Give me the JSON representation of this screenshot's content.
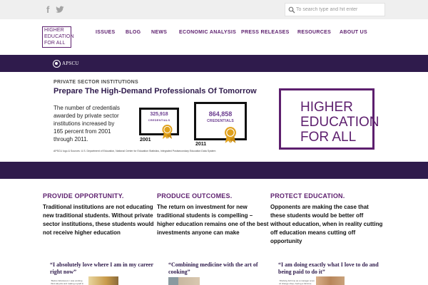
{
  "topbar": {
    "social": [
      "facebook-icon",
      "twitter-icon"
    ],
    "search": {
      "placeholder": "To search type and hit enter",
      "icon": "search-icon"
    }
  },
  "header": {
    "logo_lines": [
      "HIGHER",
      "EDUCATION",
      "FOR ALL"
    ],
    "nav": [
      "ISSUES",
      "BLOG",
      "NEWS",
      "ECONOMIC ANALYSIS",
      "PRESS RELEASES",
      "RESOURCES",
      "ABOUT US"
    ]
  },
  "banner": {
    "apscu_logo": "APSCU",
    "label": "PRIVATE SECTOR INSTITUTIONS",
    "title": "Prepare The High-Demand Professionals Of Tomorrow",
    "text": "The number of credentials awarded by private sector institutions increased by 165 percent from 2001 through 2011.",
    "cert_2001": {
      "value": "325,918",
      "sub": "CREDENTIALS",
      "year": "2001"
    },
    "cert_2011": {
      "value": "864,858",
      "sub": "CREDENTIALS",
      "year": "2011"
    },
    "source": "APSCU logo & Sources: U.S. Department of Education, National Center for Education Statistics, Integrated Postsecondary Education Data System",
    "big_logo_lines": [
      "HIGHER",
      "EDUCATION",
      "FOR ALL"
    ]
  },
  "columns": [
    {
      "heading": "PROVIDE OPPORTUNITY.",
      "text": "Traditional institutions are not educating new traditional students. Without private sector institutions, these students would not receive higher education",
      "quote": "“I absolutely love where I am in my career right now”",
      "snippet": "“Before Westwood, I was working third-rail jobs and making myself in the wrong direction. I was hanging out with the wrong crowd and"
    },
    {
      "heading": "PRODUCE OUTCOMES.",
      "text": "The return on investment for new traditional students is compelling – higher education remains one of the best investments anyone can make",
      "quote": "“Combining medicine with the art of cooking”",
      "snippet": ""
    },
    {
      "heading": "PROTECT EDUCATION.",
      "text": "Opponents are making the case that these students would be better off without education, when in reality cutting off education means cutting off opportunity",
      "quote": "“I am doing exactly what I love to do and being paid to do it”",
      "snippet": "“Working full time as a manager at an oil change shop, having a full-time load, balancing the birth of my first child and"
    }
  ],
  "colors": {
    "brand_purple": "#5d1f6e",
    "band_dark": "#2f1b4c",
    "topbar_grey": "#efefef",
    "cert_purple": "#6b3c8f",
    "seal_gold": "#e0a11c"
  }
}
